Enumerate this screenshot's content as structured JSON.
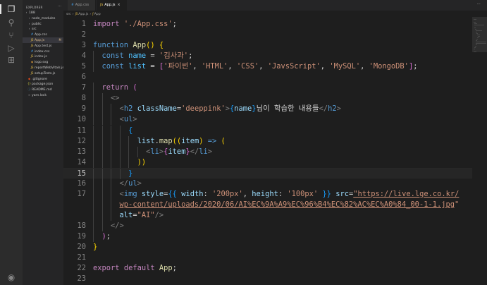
{
  "activity_bar": {
    "icons": [
      "files-icon",
      "search-icon",
      "source-control-icon",
      "run-debug-icon",
      "extensions-icon",
      "account-icon"
    ]
  },
  "explorer": {
    "title": "EXPLORER",
    "more": "···",
    "items": [
      {
        "label": "188",
        "icon": "folder",
        "depth": 0
      },
      {
        "label": "node_modules",
        "icon": "folder",
        "depth": 1
      },
      {
        "label": "public",
        "icon": "folder",
        "depth": 1
      },
      {
        "label": "src",
        "icon": "folder",
        "depth": 1
      },
      {
        "label": "App.css",
        "icon": "css",
        "depth": 2
      },
      {
        "label": "App.js",
        "icon": "js",
        "depth": 2,
        "badge": "M"
      },
      {
        "label": "App.test.js",
        "icon": "js",
        "depth": 2
      },
      {
        "label": "index.css",
        "icon": "css",
        "depth": 2
      },
      {
        "label": "index.js",
        "icon": "js",
        "depth": 2
      },
      {
        "label": "logo.svg",
        "icon": "svg",
        "depth": 2
      },
      {
        "label": "reportWebVitals.js",
        "icon": "js",
        "depth": 2
      },
      {
        "label": "setupTests.js",
        "icon": "js",
        "depth": 2
      },
      {
        "label": ".gitignore",
        "icon": "git",
        "depth": 1
      },
      {
        "label": "package.json",
        "icon": "json",
        "depth": 1
      },
      {
        "label": "README.md",
        "icon": "md",
        "depth": 1
      },
      {
        "label": "yarn.lock",
        "icon": "file",
        "depth": 1
      }
    ]
  },
  "tabs": [
    {
      "label": "App.css",
      "icon": "#",
      "active": false
    },
    {
      "label": "App.js",
      "icon": "JS",
      "active": true,
      "close": "×"
    }
  ],
  "tab_actions": "⋯",
  "breadcrumb": [
    "src",
    "App.js",
    "App"
  ],
  "editor": {
    "active_line": 15,
    "lines": [
      {
        "n": "1",
        "tokens": [
          [
            "kw",
            "import"
          ],
          [
            "punc",
            " "
          ],
          [
            "str",
            "'./App.css'"
          ],
          [
            "punc",
            ";"
          ]
        ]
      },
      {
        "n": "2",
        "tokens": []
      },
      {
        "n": "3",
        "tokens": [
          [
            "kw2",
            "function"
          ],
          [
            "punc",
            " "
          ],
          [
            "fn",
            "App"
          ],
          [
            "br1",
            "()"
          ],
          [
            "punc",
            " "
          ],
          [
            "br1",
            "{"
          ]
        ]
      },
      {
        "n": "4",
        "indent": 1,
        "tokens": [
          [
            "kw2",
            "const"
          ],
          [
            "punc",
            " "
          ],
          [
            "const",
            "name"
          ],
          [
            "punc",
            " = "
          ],
          [
            "str",
            "'김사과'"
          ],
          [
            "punc",
            ";"
          ]
        ]
      },
      {
        "n": "5",
        "indent": 1,
        "tokens": [
          [
            "kw2",
            "const"
          ],
          [
            "punc",
            " "
          ],
          [
            "const",
            "list"
          ],
          [
            "punc",
            " = "
          ],
          [
            "br2",
            "["
          ],
          [
            "str",
            "'파이썬'"
          ],
          [
            "punc",
            ", "
          ],
          [
            "str",
            "'HTML'"
          ],
          [
            "punc",
            ", "
          ],
          [
            "str",
            "'CSS'"
          ],
          [
            "punc",
            ", "
          ],
          [
            "str",
            "'JavsScript'"
          ],
          [
            "punc",
            ", "
          ],
          [
            "str",
            "'MySQL'"
          ],
          [
            "punc",
            ", "
          ],
          [
            "str",
            "'MongoDB'"
          ],
          [
            "br2",
            "]"
          ],
          [
            "punc",
            ";"
          ]
        ]
      },
      {
        "n": "6",
        "tokens": []
      },
      {
        "n": "7",
        "indent": 1,
        "tokens": [
          [
            "kw",
            "return"
          ],
          [
            "punc",
            " "
          ],
          [
            "br2",
            "("
          ]
        ]
      },
      {
        "n": "8",
        "indent": 2,
        "tokens": [
          [
            "tagp",
            "<>"
          ]
        ]
      },
      {
        "n": "9",
        "indent": 3,
        "tokens": [
          [
            "tagp",
            "<"
          ],
          [
            "tag",
            "h2"
          ],
          [
            "punc",
            " "
          ],
          [
            "attr",
            "className"
          ],
          [
            "punc",
            "="
          ],
          [
            "str",
            "'deeppink'"
          ],
          [
            "tagp",
            ">"
          ],
          [
            "br3",
            "{"
          ],
          [
            "var",
            "name"
          ],
          [
            "br3",
            "}"
          ],
          [
            "txt",
            "님이 학습한 내용들"
          ],
          [
            "tagp",
            "</"
          ],
          [
            "tag",
            "h2"
          ],
          [
            "tagp",
            ">"
          ]
        ]
      },
      {
        "n": "10",
        "indent": 3,
        "tokens": [
          [
            "tagp",
            "<"
          ],
          [
            "tag",
            "ul"
          ],
          [
            "tagp",
            ">"
          ]
        ]
      },
      {
        "n": "11",
        "indent": 4,
        "tokens": [
          [
            "br3",
            "{"
          ]
        ]
      },
      {
        "n": "12",
        "indent": 5,
        "tokens": [
          [
            "var",
            "list"
          ],
          [
            "punc",
            "."
          ],
          [
            "fn",
            "map"
          ],
          [
            "br1",
            "(("
          ],
          [
            "var",
            "item"
          ],
          [
            "br1",
            ")"
          ],
          [
            "punc",
            " "
          ],
          [
            "kw2",
            "=>"
          ],
          [
            "punc",
            " "
          ],
          [
            "br1",
            "("
          ]
        ]
      },
      {
        "n": "13",
        "indent": 6,
        "tokens": [
          [
            "tagp",
            "<"
          ],
          [
            "tag",
            "li"
          ],
          [
            "tagp",
            ">"
          ],
          [
            "br2",
            "{"
          ],
          [
            "var",
            "item"
          ],
          [
            "br2",
            "}"
          ],
          [
            "tagp",
            "</"
          ],
          [
            "tag",
            "li"
          ],
          [
            "tagp",
            ">"
          ]
        ]
      },
      {
        "n": "14",
        "indent": 5,
        "tokens": [
          [
            "br1",
            "))"
          ]
        ]
      },
      {
        "n": "15",
        "indent": 4,
        "tokens": [
          [
            "br3",
            "}"
          ]
        ]
      },
      {
        "n": "16",
        "indent": 3,
        "tokens": [
          [
            "tagp",
            "</"
          ],
          [
            "tag",
            "ul"
          ],
          [
            "tagp",
            ">"
          ]
        ]
      },
      {
        "n": "17",
        "indent": 3,
        "tokens": [
          [
            "tagp",
            "<"
          ],
          [
            "tag",
            "img"
          ],
          [
            "punc",
            " "
          ],
          [
            "attr",
            "style"
          ],
          [
            "punc",
            "="
          ],
          [
            "br3",
            "{{"
          ],
          [
            "punc",
            " "
          ],
          [
            "var",
            "width"
          ],
          [
            "punc",
            ": "
          ],
          [
            "str",
            "'200px'"
          ],
          [
            "punc",
            ", "
          ],
          [
            "var",
            "height"
          ],
          [
            "punc",
            ": "
          ],
          [
            "str",
            "'100px'"
          ],
          [
            "punc",
            " "
          ],
          [
            "br3",
            "}}"
          ],
          [
            "punc",
            " "
          ],
          [
            "attr",
            "src"
          ],
          [
            "punc",
            "="
          ],
          [
            "link",
            "\"https://live.lge.co.kr/"
          ]
        ]
      },
      {
        "n": "",
        "indent": 3,
        "tokens": [
          [
            "link",
            "wp-content/uploads/2020/06/AI%EC%9A%A9%EC%96%B4%EC%82%AC%EC%A0%84_00-1-1.jpg"
          ],
          [
            "str",
            "\""
          ]
        ]
      },
      {
        "n": "",
        "indent": 3,
        "tokens": [
          [
            "attr",
            "alt"
          ],
          [
            "punc",
            "="
          ],
          [
            "str",
            "\"AI\""
          ],
          [
            "tagp",
            "/>"
          ]
        ]
      },
      {
        "n": "18",
        "indent": 2,
        "tokens": [
          [
            "tagp",
            "</>"
          ]
        ]
      },
      {
        "n": "19",
        "indent": 1,
        "tokens": [
          [
            "br2",
            ")"
          ],
          [
            "punc",
            ";"
          ]
        ]
      },
      {
        "n": "20",
        "tokens": [
          [
            "br1",
            "}"
          ]
        ]
      },
      {
        "n": "21",
        "tokens": []
      },
      {
        "n": "22",
        "tokens": [
          [
            "kw",
            "export"
          ],
          [
            "punc",
            " "
          ],
          [
            "kw",
            "default"
          ],
          [
            "punc",
            " "
          ],
          [
            "fn",
            "App"
          ],
          [
            "punc",
            ";"
          ]
        ]
      },
      {
        "n": "23",
        "tokens": []
      }
    ]
  }
}
